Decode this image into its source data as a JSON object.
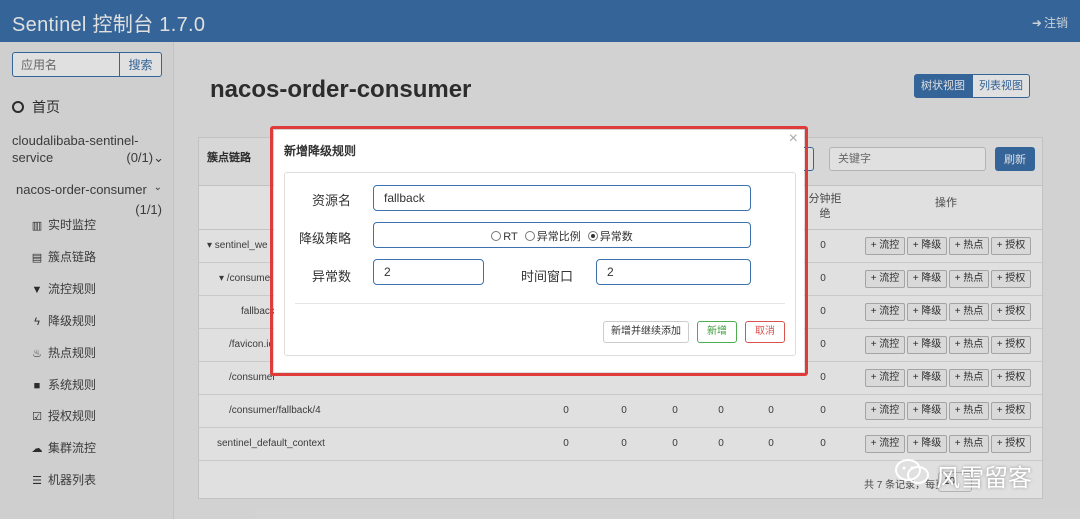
{
  "topbar": {
    "brand": "Sentinel 控制台 1.7.0",
    "logout": "注销"
  },
  "sidebar": {
    "search_placeholder": "应用名",
    "search_button": "搜索",
    "home": "首页",
    "app1": {
      "name": "cloudalibaba-sentinel-service",
      "count": "(0/1)"
    },
    "app2": {
      "name": "nacos-order-consumer",
      "count": "(1/1)"
    },
    "menu": [
      {
        "icon": "bar-chart-icon",
        "label": "实时监控"
      },
      {
        "icon": "list-icon",
        "label": "簇点链路"
      },
      {
        "icon": "filter-icon",
        "label": "流控规则"
      },
      {
        "icon": "flash-icon",
        "label": "降级规则"
      },
      {
        "icon": "fire-icon",
        "label": "热点规则"
      },
      {
        "icon": "lock-icon",
        "label": "系统规则"
      },
      {
        "icon": "check-icon",
        "label": "授权规则"
      },
      {
        "icon": "cloud-icon",
        "label": "集群流控"
      },
      {
        "icon": "th-list-icon",
        "label": "机器列表"
      }
    ]
  },
  "main": {
    "title": "nacos-order-consumer",
    "tree_view": "树状视图",
    "list_view": "列表视图",
    "panel_title": "簇点链路",
    "keyword_placeholder": "关键字",
    "refresh": "刷新",
    "col_block": "分钟拒绝",
    "col_ops": "操作",
    "op_labels": [
      "+ 流控",
      "+ 降级",
      "+ 热点",
      "+ 授权"
    ],
    "rows": [
      {
        "resource": "sentinel_web_servlet_context",
        "shown": "▾ sentinel_we",
        "values": [
          "",
          "",
          "",
          "",
          "",
          "0"
        ]
      },
      {
        "resource": "/consumer",
        "shown": "▾ /consume",
        "values": [
          "",
          "",
          "",
          "",
          "",
          "0"
        ]
      },
      {
        "resource": "fallback",
        "shown": "fallback",
        "values": [
          "",
          "",
          "",
          "",
          "",
          "0"
        ]
      },
      {
        "resource": "/favicon.ico",
        "shown": "/favicon.ic",
        "values": [
          "",
          "",
          "",
          "",
          "",
          "0"
        ]
      },
      {
        "resource": "/consumer",
        "shown": "/consumer",
        "values": [
          "",
          "",
          "",
          "",
          "",
          "0"
        ]
      },
      {
        "resource": "/consumer/fallback/4",
        "shown": "/consumer/fallback/4",
        "values": [
          "0",
          "0",
          "0",
          "0",
          "0",
          "0"
        ]
      },
      {
        "resource": "sentinel_default_context",
        "shown": "sentinel_default_context",
        "values": [
          "0",
          "0",
          "0",
          "0",
          "0",
          "0"
        ]
      }
    ],
    "footer": "共 7 条记录，每页",
    "page_size": "10"
  },
  "modal": {
    "title": "新增降级规则",
    "close": "×",
    "resource_label": "资源名",
    "resource_value": "fallback",
    "strategy_label": "降级策略",
    "strategies": [
      {
        "label": "RT",
        "checked": false
      },
      {
        "label": "异常比例",
        "checked": false
      },
      {
        "label": "异常数",
        "checked": true
      }
    ],
    "count_label": "异常数",
    "count_value": "2",
    "window_label": "时间窗口",
    "window_value": "2",
    "btn_add_continue": "新增并继续添加",
    "btn_add": "新增",
    "btn_cancel": "取消"
  },
  "watermark": {
    "text": "风雪留客"
  }
}
